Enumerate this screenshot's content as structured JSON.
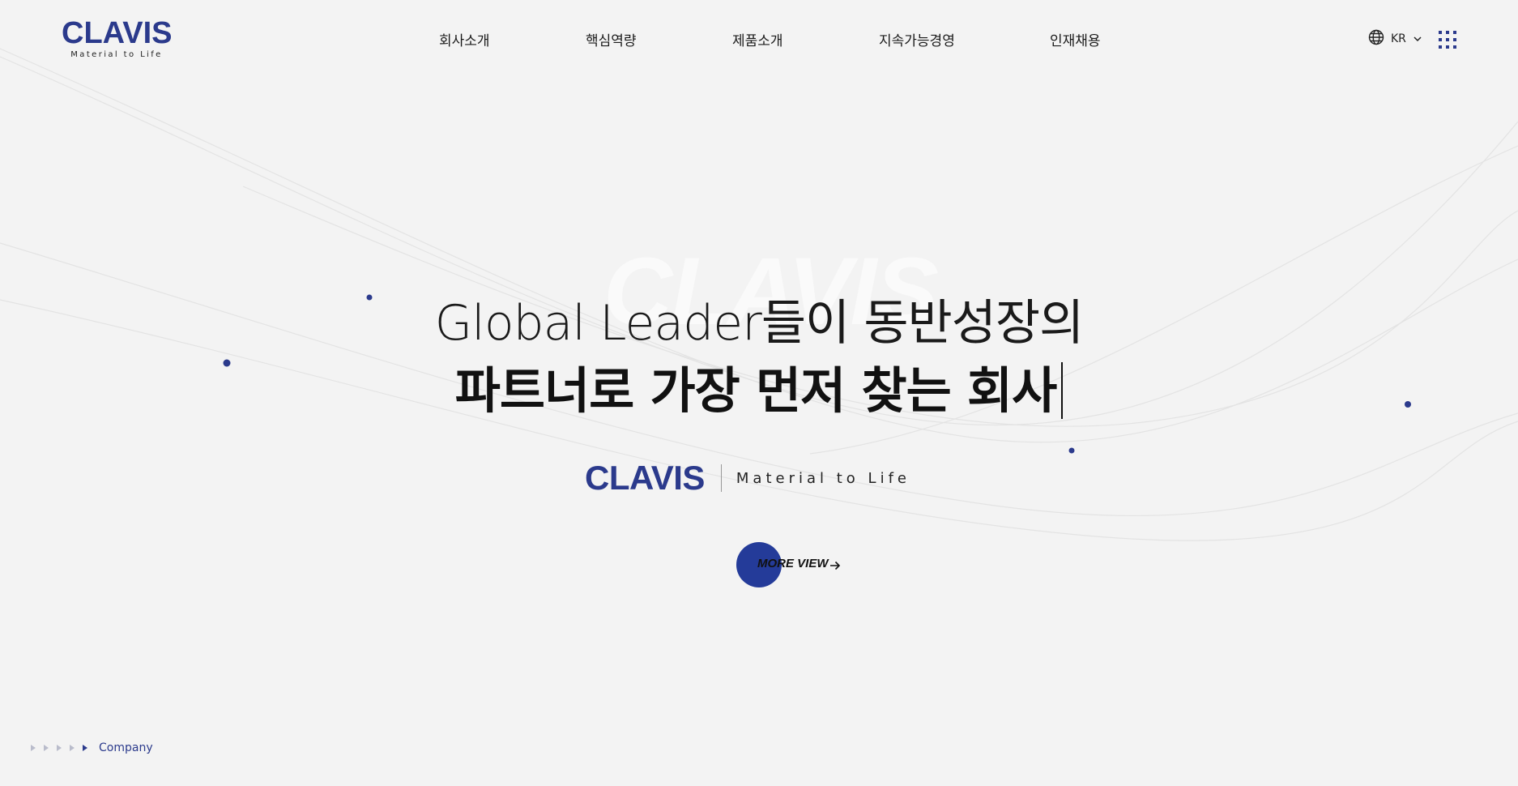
{
  "brand": {
    "logo_text": "CLAVIS",
    "tagline": "Material to Life",
    "primary_color": "#2b3a8c",
    "accent_color": "#243b99"
  },
  "nav": {
    "items": [
      {
        "label": "회사소개"
      },
      {
        "label": "핵심역량"
      },
      {
        "label": "제품소개"
      },
      {
        "label": "지속가능경영"
      },
      {
        "label": "인재채용"
      }
    ]
  },
  "lang": {
    "current": "KR",
    "icon": "globe-icon"
  },
  "menu": {
    "icon": "grid-menu-icon"
  },
  "hero": {
    "watermark": "CLAVIS",
    "headline_line1": "Global Leader들이 동반성장의",
    "headline_line2": "파트너로 가장 먼저 찾는 회사",
    "brand_word": "CLAVIS",
    "brand_tagline": "Material to Life",
    "cta_label": "MORE VIEW",
    "cta_icon": "arrow-right-icon"
  },
  "footer": {
    "section_label": "Company",
    "steps_total": 5,
    "active_step": 5
  }
}
